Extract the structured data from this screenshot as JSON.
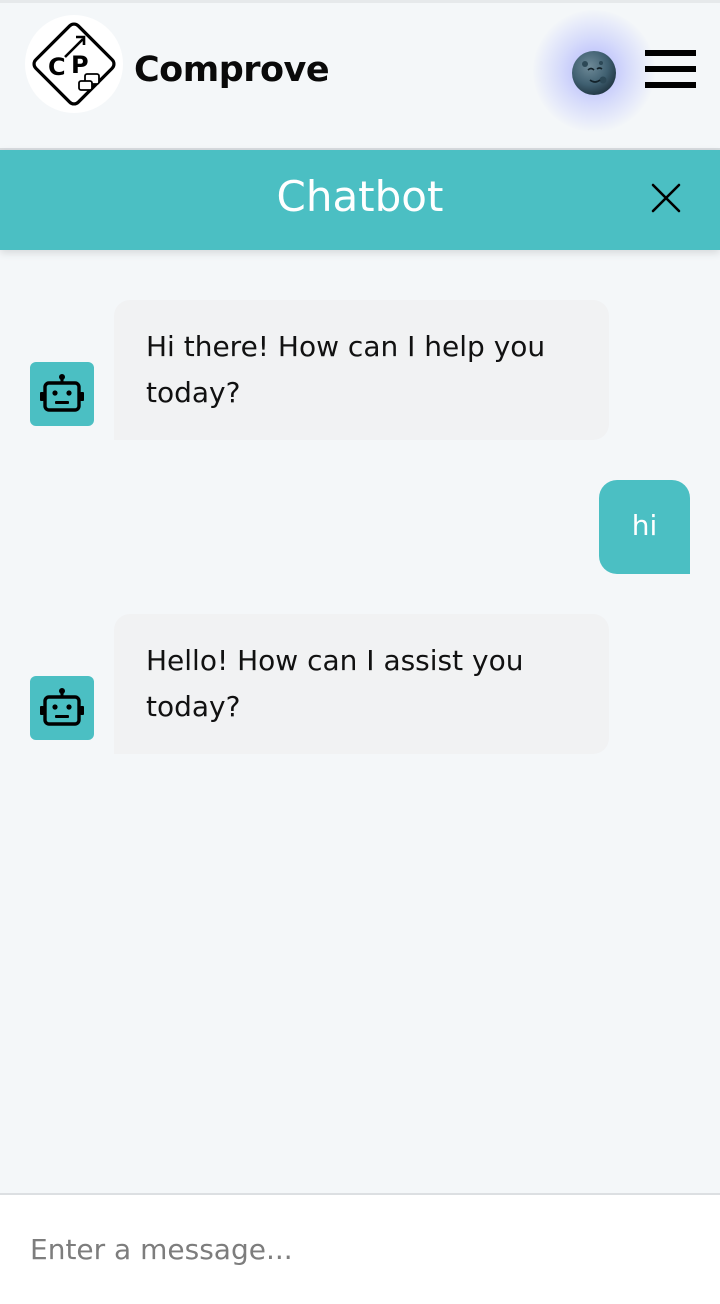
{
  "navbar": {
    "brand": "Comprove",
    "logo_text": "CP",
    "theme_icon": "moon-face-icon",
    "menu_icon": "hamburger-menu-icon"
  },
  "chat": {
    "title": "Chatbot",
    "close_icon": "close-icon",
    "messages": [
      {
        "sender": "bot",
        "text": "Hi there! How can I help you today?"
      },
      {
        "sender": "user",
        "text": "hi"
      },
      {
        "sender": "bot",
        "text": "Hello! How can I assist you today?"
      }
    ]
  },
  "input": {
    "placeholder": "Enter a message...",
    "value": ""
  },
  "colors": {
    "accent": "#4bbfc3",
    "background": "#f4f7f9",
    "bot_bubble": "#f1f2f3"
  }
}
